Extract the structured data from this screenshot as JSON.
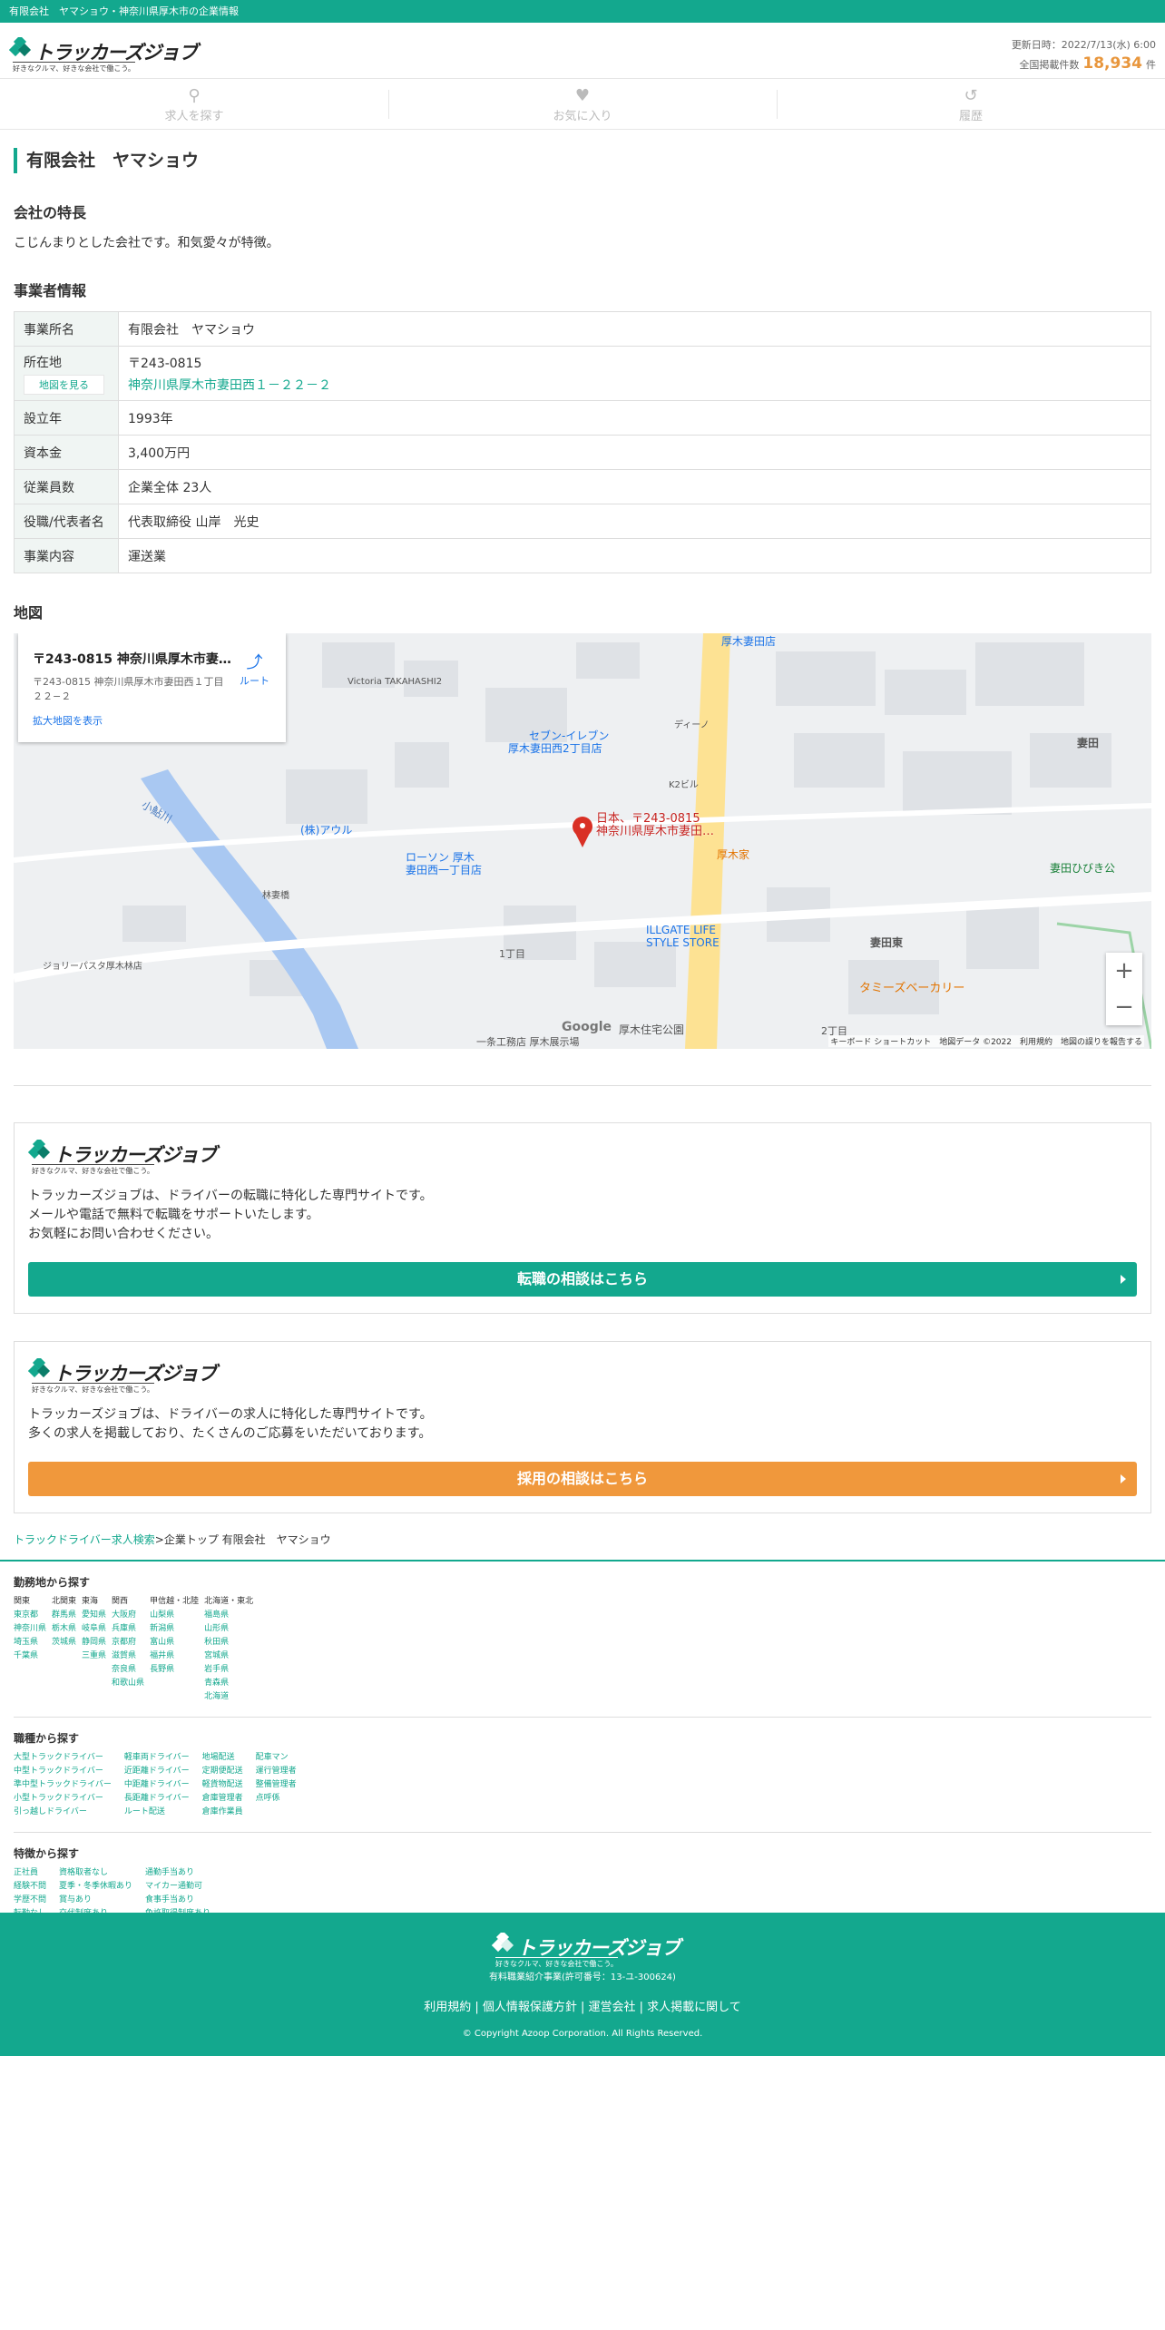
{
  "topbar": {
    "text": "有限会社　ヤマショウ・神奈川県厚木市の企業情報"
  },
  "header": {
    "logo_text": "トラッカーズジョブ",
    "logo_sub": "好きなクルマ、好きな会社で働こう。",
    "updated": "更新日時：2022/7/13(水) 6:00",
    "count_label": "全国掲載件数",
    "count": "18,934",
    "count_unit": "件"
  },
  "nav": {
    "search": "求人を探す",
    "favorite": "お気に入り",
    "history": "履歴"
  },
  "company": {
    "name": "有限会社　ヤマショウ",
    "feature_title": "会社の特長",
    "feature": "こじんまりとした会社です。和気愛々が特徴。",
    "info_title": "事業者情報",
    "rows": [
      {
        "label": "事業所名",
        "value": "有限会社　ヤマショウ"
      },
      {
        "label": "所在地",
        "zip": "〒243-0815",
        "address": "神奈川県厚木市妻田西１－２２－２",
        "map_link": "地図を見る"
      },
      {
        "label": "設立年",
        "value": "1993年"
      },
      {
        "label": "資本金",
        "value": "3,400万円"
      },
      {
        "label": "従業員数",
        "value": "企業全体 23人"
      },
      {
        "label": "役職/代表者名",
        "value": "代表取締役 山岸　光史"
      },
      {
        "label": "事業内容",
        "value": "運送業"
      }
    ]
  },
  "map": {
    "title": "地図",
    "card_title": "〒243-0815 神奈川県厚木市妻…",
    "card_address": "〒243-0815 神奈川県厚木市妻田西１丁目２２−２",
    "card_route": "ルート",
    "card_link": "拡大地図を表示",
    "pin_label1": "日本、〒243-0815",
    "pin_label2": "神奈川県厚木市妻田…",
    "footer": "キーボード ショートカット　地図データ ©2022　利用規約　地図の誤りを報告する",
    "google": "Google",
    "zoom_in": "+",
    "zoom_out": "−",
    "places": [
      "セブン-イレブン",
      "厚木妻田西2丁目店",
      "ローソン 厚木",
      "妻田西一丁目店",
      "(株)アウル",
      "厚木家",
      "ILLGATE LIFE",
      "STYLE STORE",
      "タミーズベーカリー",
      "妻田東",
      "妻田",
      "1丁目",
      "2丁目",
      "小鮎川",
      "厚木妻田店",
      "妻田ひびき公",
      "厚木住宅公園",
      "一条工務店 厚木展示場",
      "Victoria TAKAHASHI2",
      "ジョリーパスタ厚木林店",
      "林妻橋",
      "K2ビル",
      "ディーノ"
    ]
  },
  "promo1": {
    "text1": "トラッカーズジョブは、ドライバーの転職に特化した専門サイトです。",
    "text2": "メールや電話で無料で転職をサポートいたします。",
    "text3": "お気軽にお問い合わせください。",
    "button": "転職の相談はこちら"
  },
  "promo2": {
    "text1": "トラッカーズジョブは、ドライバーの求人に特化した専門サイトです。",
    "text2": "多くの求人を掲載しており、たくさんのご応募をいただいております。",
    "button": "採用の相談はこちら"
  },
  "breadcrumb": {
    "home": "トラックドライバー求人検索",
    "rest": ">企業トップ 有限会社　ヤマショウ"
  },
  "area": {
    "title": "勤務地から探す",
    "regions": [
      {
        "name": "関東",
        "items": [
          "東京都",
          "神奈川県",
          "埼玉県",
          "千葉県"
        ]
      },
      {
        "name": "北関東",
        "items": [
          "群馬県",
          "栃木県",
          "茨城県"
        ]
      },
      {
        "name": "東海",
        "items": [
          "愛知県",
          "岐阜県",
          "静岡県",
          "三重県"
        ]
      },
      {
        "name": "関西",
        "items": [
          "大阪府",
          "兵庫県",
          "京都府",
          "滋賀県",
          "奈良県",
          "和歌山県"
        ]
      },
      {
        "name": "甲信越・北陸",
        "items": [
          "山梨県",
          "新潟県",
          "富山県",
          "福井県",
          "長野県"
        ]
      },
      {
        "name": "北海道・東北",
        "items": [
          "福島県",
          "山形県",
          "秋田県",
          "宮城県",
          "岩手県",
          "青森県",
          "北海道"
        ]
      }
    ]
  },
  "jobtype": {
    "title": "職種から探す",
    "cols": [
      [
        "大型トラックドライバー",
        "中型トラックドライバー",
        "準中型トラックドライバー",
        "小型トラックドライバー",
        "引っ越しドライバー"
      ],
      [
        "軽車両ドライバー",
        "近距離ドライバー",
        "中距離ドライバー",
        "長距離ドライバー",
        "ルート配送"
      ],
      [
        "地場配送",
        "定期便配送",
        "軽貨物配送",
        "倉庫管理者",
        "倉庫作業員"
      ],
      [
        "配車マン",
        "運行管理者",
        "整備管理者",
        "点呼係"
      ]
    ]
  },
  "features": {
    "title": "特徴から探す",
    "cols": [
      [
        "正社員",
        "経験不問",
        "学歴不問",
        "転勤なし"
      ],
      [
        "資格取者なし",
        "夏季・冬季休暇あり",
        "賞与あり",
        "交代制度あり"
      ],
      [
        "通勤手当あり",
        "マイカー通勤可",
        "食事手当あり",
        "免許取得制度あり"
      ]
    ]
  },
  "footer": {
    "license": "有料職業紹介事業(許可番号：13-ユ-300624)",
    "links": "利用規約 | 個人情報保護方針 | 運営会社 | 求人掲載に関して",
    "copyright": "© Copyright Azoop Corporation. All Rights Reserved."
  },
  "colors": {
    "brand": "#13a88e",
    "accent": "#f0983c"
  }
}
